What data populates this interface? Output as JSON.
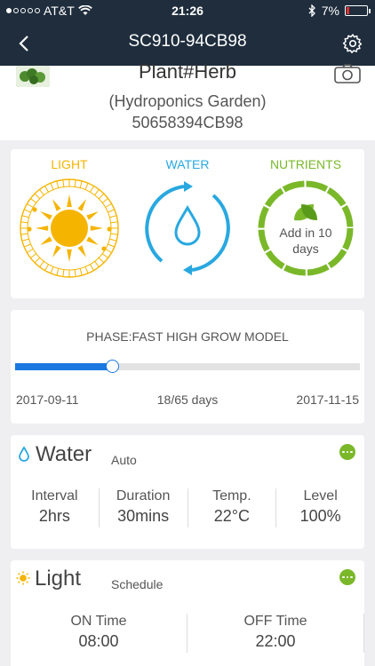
{
  "status_bar": {
    "carrier": "AT&T",
    "time": "21:26",
    "battery": "7%"
  },
  "nav": {
    "title": "SC910-94CB98"
  },
  "plant": {
    "name": "Plant#Herb",
    "type": "(Hydroponics Garden)",
    "code": "50658394CB98"
  },
  "status": {
    "light_label": "LIGHT",
    "water_label": "WATER",
    "nutrients_label": "NUTRIENTS",
    "nutrients_line1": "Add in 10",
    "nutrients_line2": "days",
    "colors": {
      "light": "#f5b400",
      "water": "#29a8e0",
      "nutrients": "#7ab829"
    }
  },
  "phase": {
    "title": "PHASE:FAST HIGH GROW MODEL",
    "start": "2017-09-11",
    "progress": "18/65 days",
    "end": "2017-11-15",
    "fraction": 0.28
  },
  "water": {
    "title": "Water",
    "mode": "Auto",
    "stats": [
      {
        "label": "Interval",
        "value": "2hrs"
      },
      {
        "label": "Duration",
        "value": "30mins"
      },
      {
        "label": "Temp.",
        "value": "22°C"
      },
      {
        "label": "Level",
        "value": "100%"
      }
    ]
  },
  "light": {
    "title": "Light",
    "mode": "Schedule",
    "stats": [
      {
        "label": "ON Time",
        "value": "08:00"
      },
      {
        "label": "OFF Time",
        "value": "22:00"
      }
    ]
  }
}
